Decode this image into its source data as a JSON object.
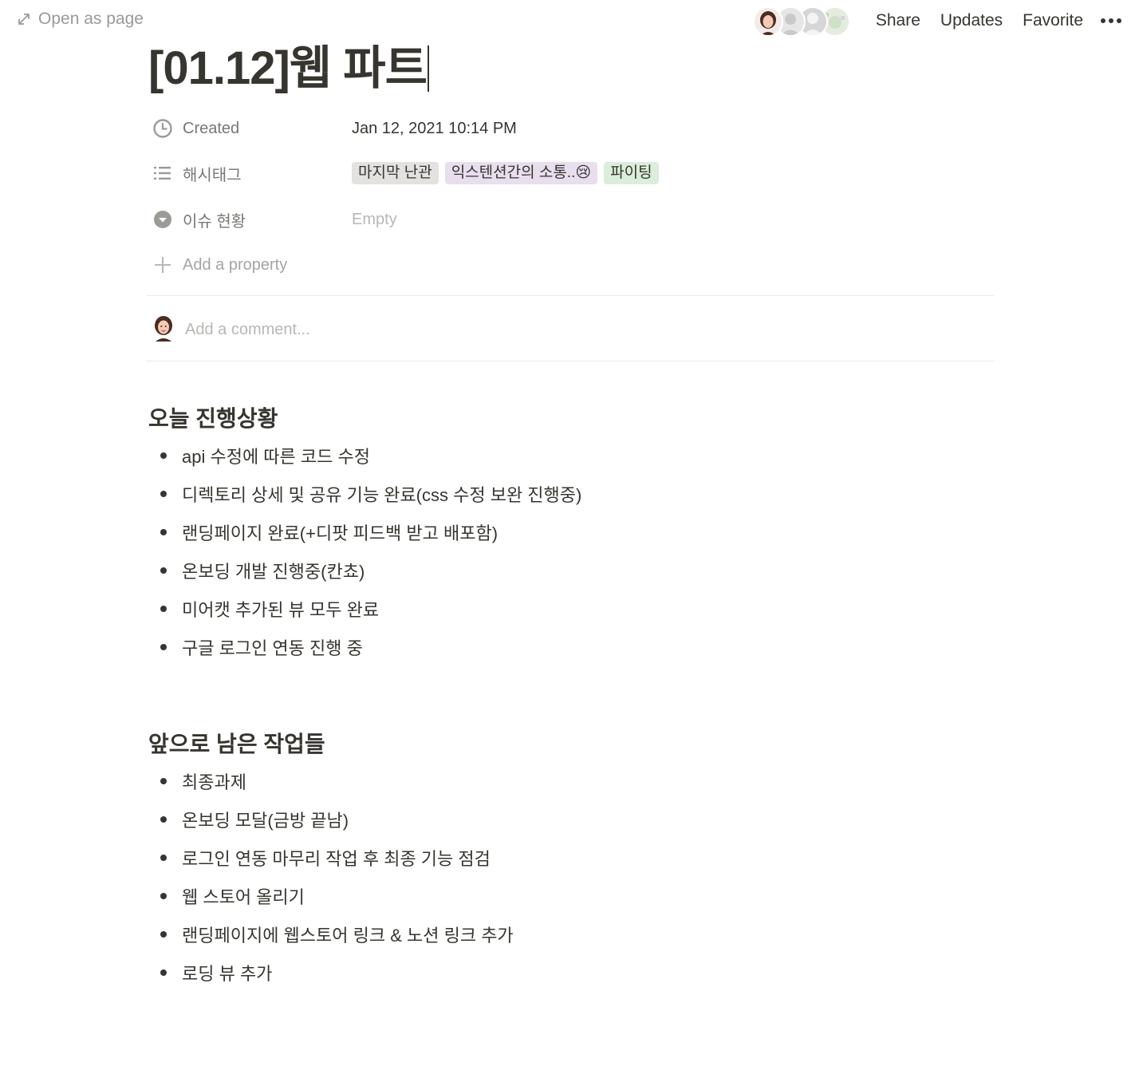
{
  "topbar": {
    "open_as_page": "Open as page",
    "actions": {
      "share": "Share",
      "updates": "Updates",
      "favorite": "Favorite"
    }
  },
  "page": {
    "title": "[01.12]웹 파트"
  },
  "properties": {
    "created": {
      "label": "Created",
      "value": "Jan 12, 2021 10:14 PM",
      "icon": "clock-icon"
    },
    "hashtags": {
      "label": "해시태그",
      "icon": "list-icon",
      "tags": [
        {
          "text": "마지막 난관",
          "color": "#e3e2e0"
        },
        {
          "text": "익스텐션간의 소통..😢",
          "color": "#e8deee"
        },
        {
          "text": "파이팅",
          "color": "#dbeddb"
        }
      ]
    },
    "issue_status": {
      "label": "이슈 현황",
      "value": "Empty",
      "icon": "select-icon"
    },
    "add_property": "Add a property"
  },
  "comment": {
    "placeholder": "Add a comment..."
  },
  "sections": [
    {
      "heading": "오늘 진행상황",
      "items": [
        "api 수정에 따른 코드 수정",
        "디렉토리 상세 및 공유 기능 완료(css 수정 보완 진행중)",
        "랜딩페이지 완료(+디팟 피드백 받고 배포함)",
        "온보딩 개발 진행중(칸쵸)",
        "미어캣 추가된 뷰 모두 완료",
        "구글 로그인 연동 진행 중"
      ]
    },
    {
      "heading": "앞으로 남은 작업들",
      "items": [
        "최종과제",
        "온보딩 모달(금방 끝남)",
        "로그인 연동 마무리 작업 후 최종 기능 점검",
        "웹 스토어 올리기",
        "랜딩페이지에 웹스토어 링크 & 노션 링크 추가",
        "로딩 뷰 추가"
      ]
    }
  ]
}
